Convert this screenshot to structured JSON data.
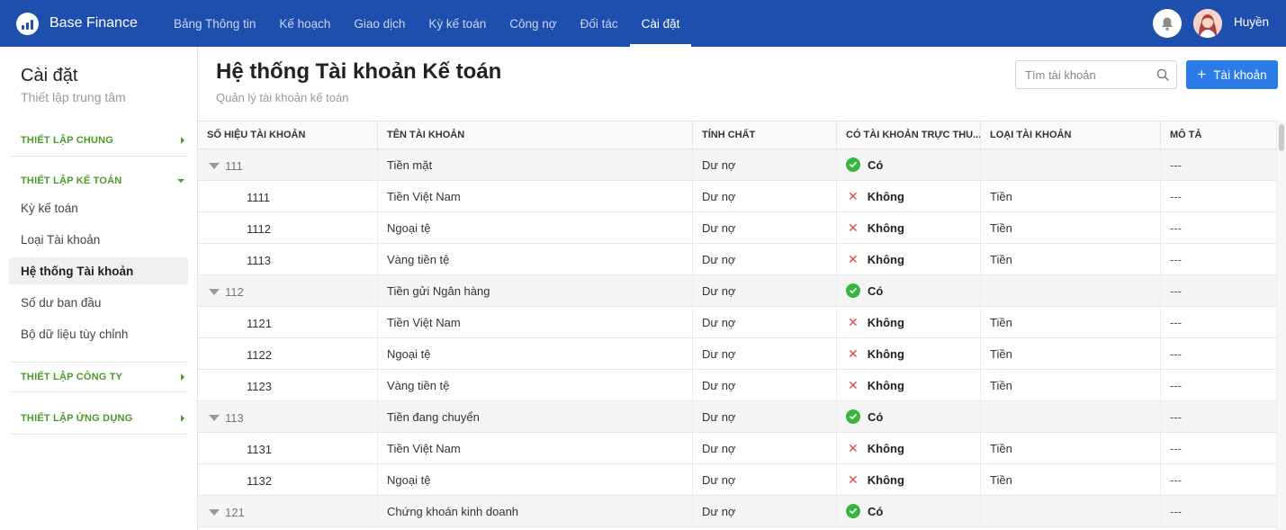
{
  "app": {
    "name": "Base Finance"
  },
  "nav": [
    {
      "label": "Bảng Thông tin",
      "active": false
    },
    {
      "label": "Kế hoạch",
      "active": false
    },
    {
      "label": "Giao dịch",
      "active": false
    },
    {
      "label": "Kỳ kế toán",
      "active": false
    },
    {
      "label": "Công nợ",
      "active": false
    },
    {
      "label": "Đối tác",
      "active": false
    },
    {
      "label": "Cài đặt",
      "active": true
    }
  ],
  "user": {
    "name": "Huyền"
  },
  "sidebar": {
    "title": "Cài đặt",
    "subtitle": "Thiết lập trung tâm",
    "groups": [
      {
        "label": "THIẾT LẬP CHUNG",
        "expanded": false
      },
      {
        "label": "THIẾT LẬP KẾ TOÁN",
        "expanded": true
      },
      {
        "label": "THIẾT LẬP CÔNG TY",
        "expanded": false
      },
      {
        "label": "THIẾT LẬP ỨNG DỤNG",
        "expanded": false
      }
    ],
    "items": [
      {
        "label": "Kỳ kế toán",
        "active": false
      },
      {
        "label": "Loại Tài khoản",
        "active": false
      },
      {
        "label": "Hệ thống Tài khoản",
        "active": true
      },
      {
        "label": "Số dư ban đầu",
        "active": false
      },
      {
        "label": "Bộ dữ liệu tùy chỉnh",
        "active": false
      }
    ]
  },
  "main": {
    "title": "Hệ thống Tài khoản Kế toán",
    "subtitle": "Quản lý tài khoản kế toán",
    "search_placeholder": "Tìm tài khoản",
    "add_label": "Tài khoản"
  },
  "table": {
    "columns": [
      "SỐ HIỆU TÀI KHOẢN",
      "TÊN TÀI KHOẢN",
      "TÍNH CHẤT",
      "CÓ TÀI KHOẢN TRỰC THU...",
      "LOẠI TÀI KHOẢN",
      "MÔ TẢ"
    ],
    "rows": [
      {
        "code": "111",
        "parent": true,
        "name": "Tiền mặt",
        "nature": "Dư nợ",
        "has_sub": "Có",
        "has_sub_flag": true,
        "type": "",
        "desc": "---"
      },
      {
        "code": "1111",
        "parent": false,
        "name": "Tiền Việt Nam",
        "nature": "Dư nợ",
        "has_sub": "Không",
        "has_sub_flag": false,
        "type": "Tiền",
        "desc": "---"
      },
      {
        "code": "1112",
        "parent": false,
        "name": "Ngoại tệ",
        "nature": "Dư nợ",
        "has_sub": "Không",
        "has_sub_flag": false,
        "type": "Tiền",
        "desc": "---"
      },
      {
        "code": "1113",
        "parent": false,
        "name": "Vàng tiền tệ",
        "nature": "Dư nợ",
        "has_sub": "Không",
        "has_sub_flag": false,
        "type": "Tiền",
        "desc": "---"
      },
      {
        "code": "112",
        "parent": true,
        "name": "Tiền gửi Ngân hàng",
        "nature": "Dư nợ",
        "has_sub": "Có",
        "has_sub_flag": true,
        "type": "",
        "desc": "---"
      },
      {
        "code": "1121",
        "parent": false,
        "name": "Tiền Việt Nam",
        "nature": "Dư nợ",
        "has_sub": "Không",
        "has_sub_flag": false,
        "type": "Tiền",
        "desc": "---"
      },
      {
        "code": "1122",
        "parent": false,
        "name": "Ngoại tệ",
        "nature": "Dư nợ",
        "has_sub": "Không",
        "has_sub_flag": false,
        "type": "Tiền",
        "desc": "---"
      },
      {
        "code": "1123",
        "parent": false,
        "name": "Vàng tiền tệ",
        "nature": "Dư nợ",
        "has_sub": "Không",
        "has_sub_flag": false,
        "type": "Tiền",
        "desc": "---"
      },
      {
        "code": "113",
        "parent": true,
        "name": "Tiền đang chuyển",
        "nature": "Dư nợ",
        "has_sub": "Có",
        "has_sub_flag": true,
        "type": "",
        "desc": "---"
      },
      {
        "code": "1131",
        "parent": false,
        "name": "Tiền Việt Nam",
        "nature": "Dư nợ",
        "has_sub": "Không",
        "has_sub_flag": false,
        "type": "Tiền",
        "desc": "---"
      },
      {
        "code": "1132",
        "parent": false,
        "name": "Ngoại tệ",
        "nature": "Dư nợ",
        "has_sub": "Không",
        "has_sub_flag": false,
        "type": "Tiền",
        "desc": "---"
      },
      {
        "code": "121",
        "parent": true,
        "name": "Chứng khoán kinh doanh",
        "nature": "Dư nợ",
        "has_sub": "Có",
        "has_sub_flag": true,
        "type": "",
        "desc": "---"
      }
    ]
  },
  "colors": {
    "topbar": "#1e4fae",
    "accent": "#2b7ce9",
    "group_label": "#4a9a2a",
    "yes": "#38b540",
    "no": "#e04848"
  }
}
